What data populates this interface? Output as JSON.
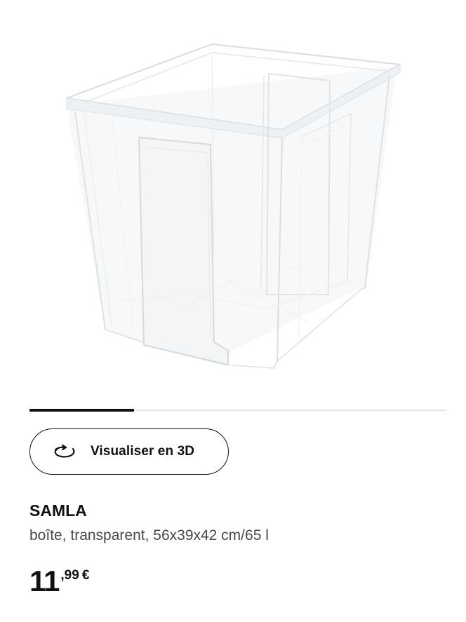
{
  "product": {
    "image_alt": "SAMLA transparent storage box",
    "name": "SAMLA",
    "description": "boîte, transparent, 56x39x42 cm/65 l",
    "price": {
      "integer": "11",
      "decimal": ",99",
      "currency": "€"
    }
  },
  "carousel": {
    "progress": 0.25
  },
  "actions": {
    "view_3d_label": "Visualiser en 3D",
    "view_3d_icon": "rotate-3d-icon"
  },
  "colors": {
    "text": "#111111",
    "secondary_text": "#484848",
    "track": "#e6e6e6",
    "accent": "#111111"
  }
}
